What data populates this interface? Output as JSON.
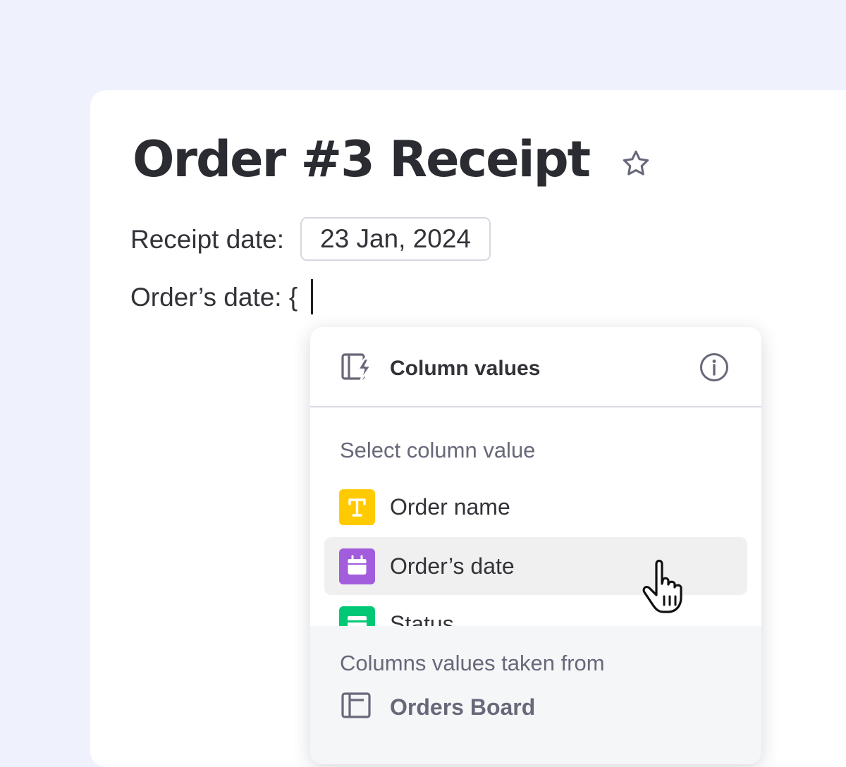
{
  "document": {
    "title": "Order #3 Receipt",
    "receipt_date_label": "Receipt date:",
    "receipt_date_value": "23 Jan, 2024",
    "order_date_label": "Order’s date: {",
    "star_icon": "star-outline-icon"
  },
  "popover": {
    "title": "Column values",
    "header_icon": "column-lightning-icon",
    "info_icon": "info-icon",
    "section_label": "Select column value",
    "options": [
      {
        "label": "Order name",
        "icon": "text-type-icon",
        "color": "#ffcb00"
      },
      {
        "label": "Order’s date",
        "icon": "calendar-icon",
        "color": "#a25ddc",
        "hovered": true
      },
      {
        "label": "Status",
        "icon": "status-icon",
        "color": "#00c875"
      }
    ],
    "footer_label": "Columns values taken from",
    "board_name": "Orders Board",
    "board_icon": "board-icon"
  },
  "colors": {
    "background": "#eff2fd",
    "text": "#323338",
    "muted": "#676879",
    "hover": "#f0f0f0"
  }
}
